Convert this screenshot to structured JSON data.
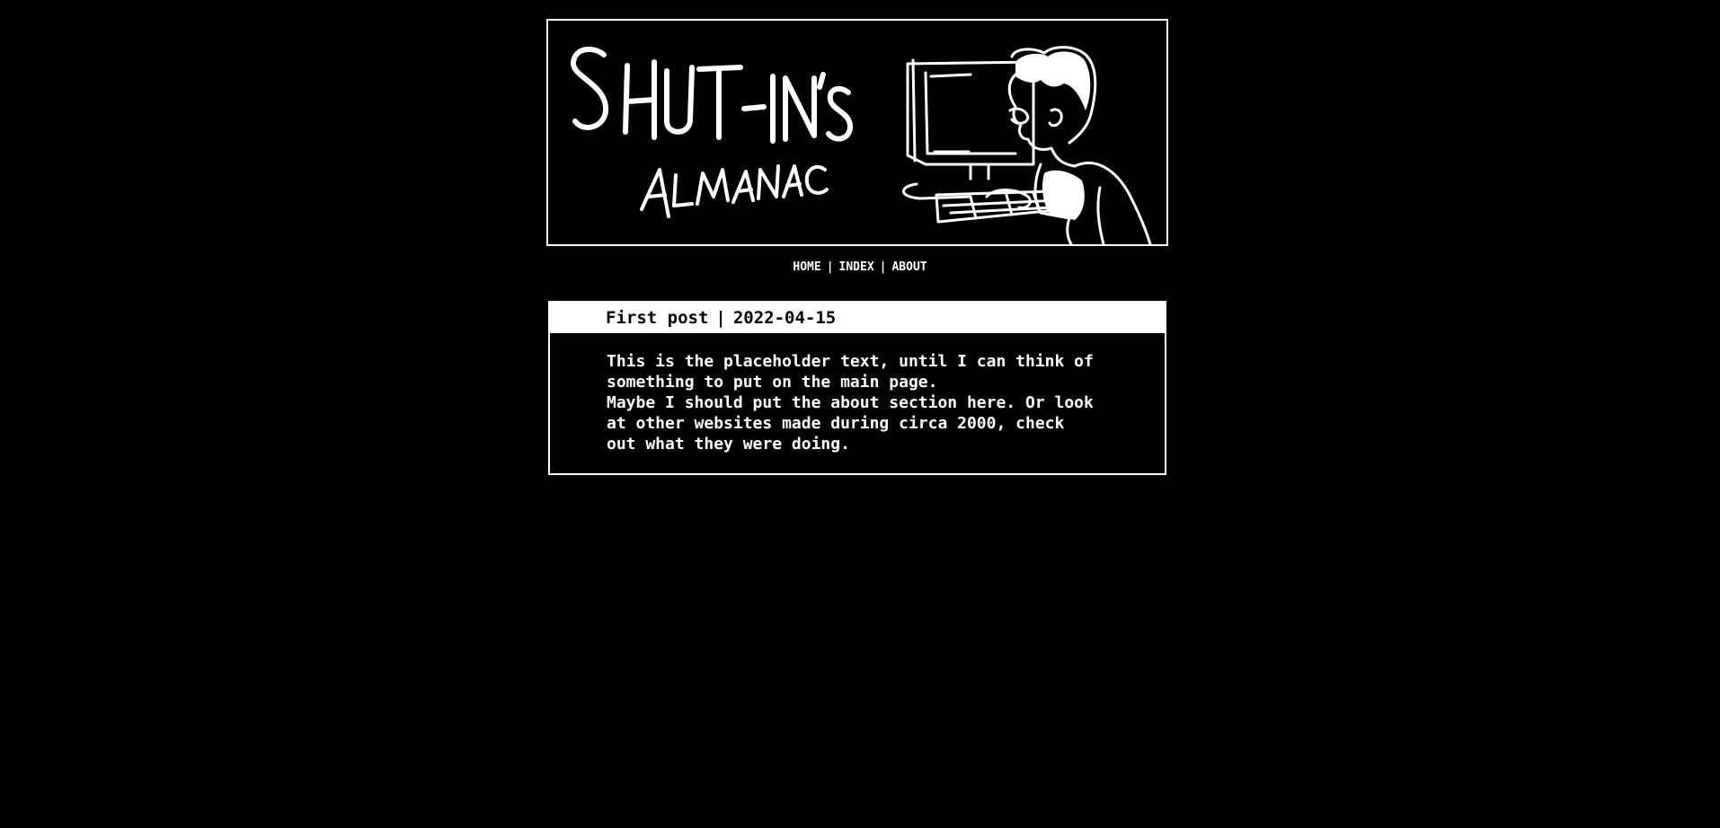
{
  "banner": {
    "title_line1": "SHUT-IN'S",
    "title_line2": "ALMANAC",
    "image": "shut-in-at-computer-illustration"
  },
  "nav": {
    "items": [
      {
        "label": "HOME"
      },
      {
        "label": "INDEX"
      },
      {
        "label": "ABOUT"
      }
    ],
    "separator": "|"
  },
  "post": {
    "title": "First post",
    "separator": "|",
    "date": "2022-04-15",
    "paragraphs": [
      "This is the placeholder text, until I can think of\nsomething to put on the main page.",
      "Maybe I should put the about section here. Or look\nat other websites made during circa 2000, check\nout what they were doing."
    ]
  },
  "colors": {
    "background": "#000000",
    "foreground": "#ffffff"
  }
}
